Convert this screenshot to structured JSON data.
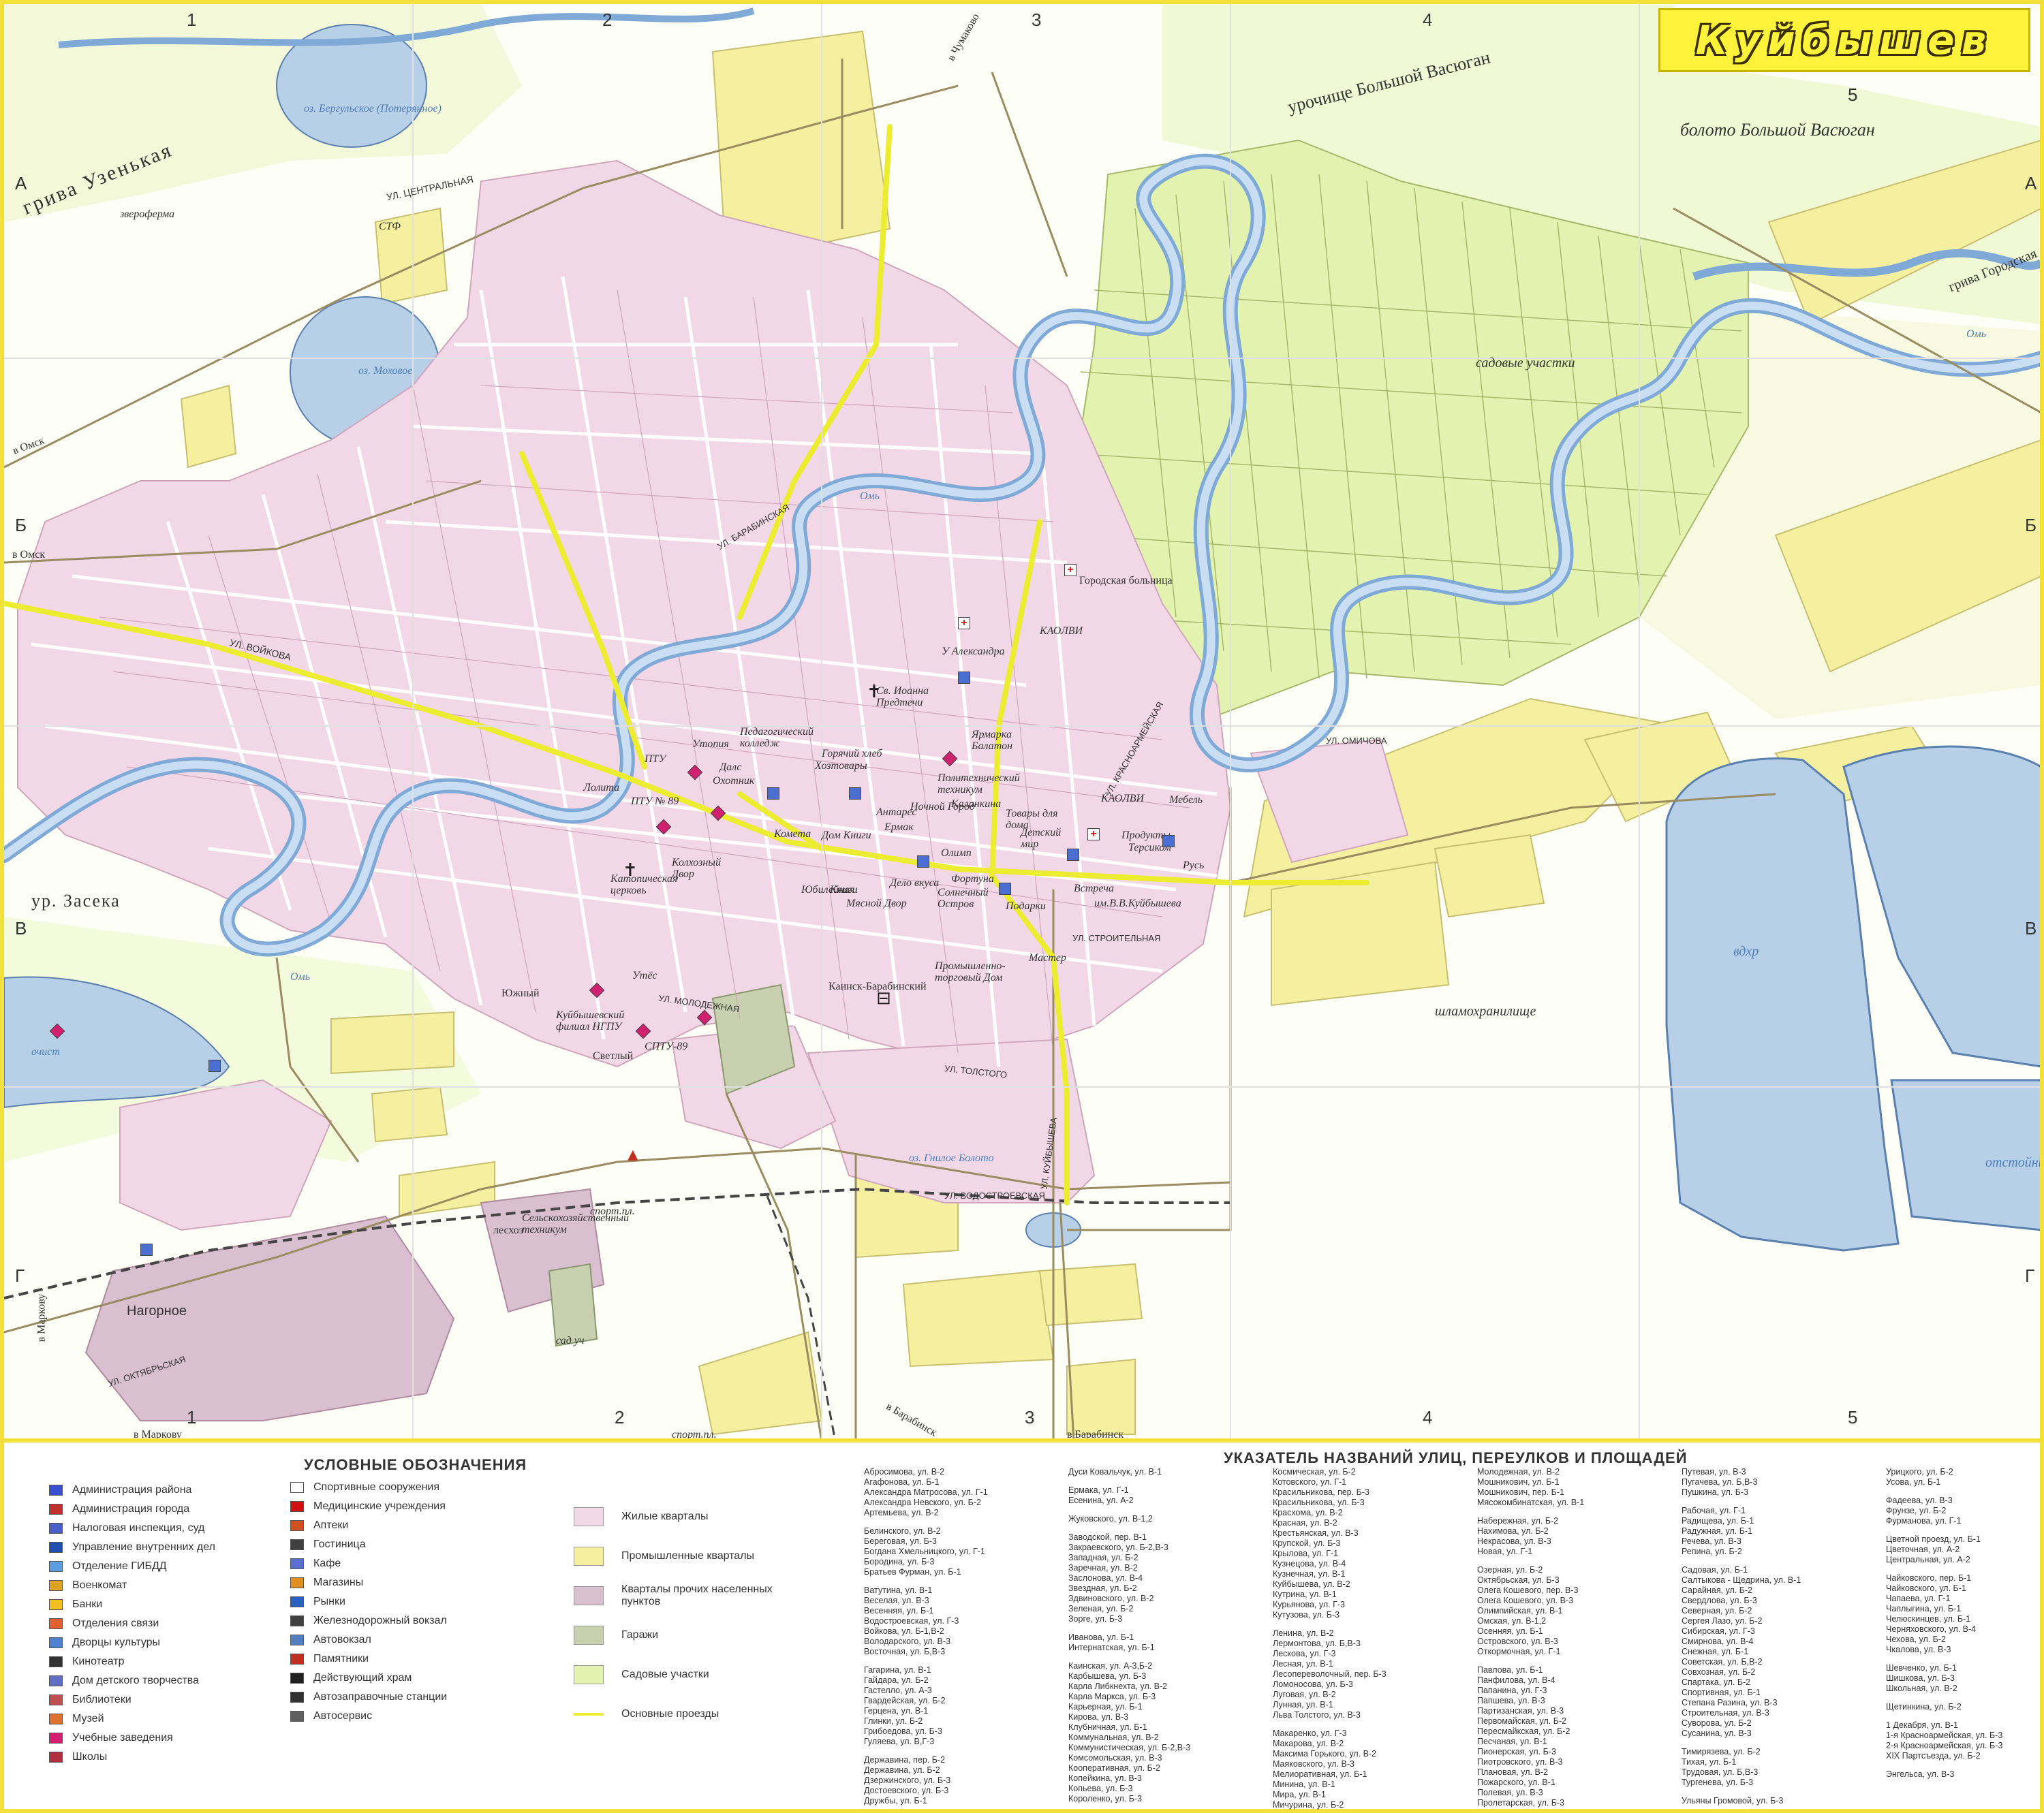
{
  "title": "Куйбышев",
  "grid": {
    "columns": [
      "1",
      "2",
      "3",
      "4",
      "5"
    ],
    "rows": [
      "А",
      "Б",
      "В",
      "Г"
    ]
  },
  "map_labels": {
    "water": [
      "оз. Бергульское (Потерянное)",
      "оз. Моховое",
      "Омь",
      "оз. Гнилое Болото",
      "шламохранилище",
      "вдхр",
      "отстойник",
      "очист",
      "Омь",
      "Омь"
    ],
    "areas": [
      "грива Узенькая",
      "болото Большой Васюган",
      "урочище Большой Васюган",
      "грива Городская",
      "садовые участки",
      "ур. Засека",
      "Нагорное",
      "Южный",
      "Светлый",
      "звероферма",
      "СТФ",
      "лесхоз",
      "спорт.пл.",
      "сад уч",
      "спорт.пл.",
      "Городская больница",
      "Каинск-Барабинский"
    ],
    "roads": [
      "в Омск",
      "в Омск",
      "в Маркову",
      "в Маркову",
      "в Барабинск",
      "в Барабинск",
      "в Чумаково"
    ],
    "streets": [
      "УЛ. ЦЕНТРАЛЬНАЯ",
      "УЛ. ВОЙКОВА",
      "УЛ. КРАСНОАРМЕЙСКАЯ",
      "УЛ. СТРОИТЕЛЬНАЯ",
      "УЛ. ОМИЧОВА",
      "УЛ. МОЛОДЕЖНАЯ",
      "УЛ. ОКТЯБРЬСКАЯ",
      "УЛ. КУЙБЫШЕВА",
      "УЛ. БАРАБИНСКАЯ",
      "УЛ. ТОЛСТОГО",
      "УЛ. ВОДОСТРОЕВСКАЯ"
    ],
    "places": [
      "ПТУ",
      "Утопия",
      "Педагогический колледж",
      "Горячий хлеб",
      "Хозтовары",
      "Далс",
      "Охотник",
      "Лолита",
      "ПТУ № 89",
      "Комета",
      "Дом Книги",
      "Антарес",
      "Ермак",
      "Олимп",
      "Фортуна",
      "Книги",
      "Мясной Двор",
      "Дело вкуса",
      "Солнечный Остров",
      "Юбилейная",
      "Катопическая церковь",
      "Колхозный Двор",
      "Политехнический техникум",
      "Каланкина",
      "Товары для дома",
      "Детский мир",
      "КАОЛВИ",
      "Мебель",
      "Продукты",
      "Терсиком",
      "Русь",
      "Встреча",
      "Подарки",
      "Мастер",
      "Промышленно-торговый Дом",
      "им.В.В.Куйбышева",
      "Сельскохозяйственный техникум",
      "Куйбышевский филиал НГПУ",
      "СПТУ-89",
      "Утёс",
      "Св. Иоанна Предтечи",
      "Ярмарка Балатон",
      "У Александра",
      "КАОЛВИ",
      "Ночной Город"
    ]
  },
  "legend": {
    "title": "УСЛОВНЫЕ ОБОЗНАЧЕНИЯ",
    "col1": [
      {
        "label": "Администрация района",
        "color": "#3a4fd0"
      },
      {
        "label": "Администрация города",
        "color": "#c03030"
      },
      {
        "label": "Налоговая инспекция, суд",
        "color": "#4a60c8"
      },
      {
        "label": "Управление внутренних дел",
        "color": "#2050b0"
      },
      {
        "label": "Отделение ГИБДД",
        "color": "#5aa0e0"
      },
      {
        "label": "Военкомат",
        "color": "#e0a020"
      },
      {
        "label": "Банки",
        "color": "#f0c020"
      },
      {
        "label": "Отделения связи",
        "color": "#e06030"
      },
      {
        "label": "Дворцы культуры",
        "color": "#5080d0"
      },
      {
        "label": "Кинотеатр",
        "color": "#333333"
      },
      {
        "label": "Дом детского творчества",
        "color": "#6070c0"
      },
      {
        "label": "Библиотеки",
        "color": "#c05050"
      },
      {
        "label": "Музей",
        "color": "#e07030"
      },
      {
        "label": "Учебные заведения",
        "color": "#d02070"
      },
      {
        "label": "Школы",
        "color": "#b03040"
      }
    ],
    "col2": [
      {
        "label": "Спортивные сооружения",
        "color": "#ffffff"
      },
      {
        "label": "Медицинские учреждения",
        "color": "#d01010"
      },
      {
        "label": "Аптеки",
        "color": "#d05020"
      },
      {
        "label": "Гостиница",
        "color": "#404040"
      },
      {
        "label": "Кафе",
        "color": "#5a70d0"
      },
      {
        "label": "Магазины",
        "color": "#e09020"
      },
      {
        "label": "Рынки",
        "color": "#2a60c0"
      },
      {
        "label": "Железнодорожный вокзал",
        "color": "#404040"
      },
      {
        "label": "Автовокзал",
        "color": "#5080c0"
      },
      {
        "label": "Памятники",
        "color": "#c03020"
      },
      {
        "label": "Действующий храм",
        "color": "#202020"
      },
      {
        "label": "Автозаправочные станции",
        "color": "#303030"
      },
      {
        "label": "Автосервис",
        "color": "#606060"
      }
    ],
    "areas": [
      {
        "label": "Жилые кварталы",
        "color": "#f2d8e6"
      },
      {
        "label": "Промышленные кварталы",
        "color": "#f4f0a0"
      },
      {
        "label": "Кварталы прочих населенных пунктов",
        "color": "#d9bfd0"
      },
      {
        "label": "Гаражи",
        "color": "#c8d0b0"
      },
      {
        "label": "Садовые участки",
        "color": "#e4f2b0"
      }
    ],
    "line": {
      "label": "Основные проезды",
      "color": "#ecec30"
    }
  },
  "street_index": {
    "title": "УКАЗАТЕЛЬ НАЗВАНИЙ УЛИЦ, ПЕРЕУЛКОВ И ПЛОЩАДЕЙ",
    "columns": [
      [
        "Абросимова, ул. В-2",
        "Агафонова, ул. Б-1",
        "Александра Матросова, ул. Г-1",
        "Александра Невского, ул. Б-2",
        "Артемьева, ул. В-2",
        "",
        "Белинского, ул. В-2",
        "Береговая, ул. Б-3",
        "Богдана Хмельницкого, ул. Г-1",
        "Бородина, ул. Б-3",
        "Братьев Фурман, ул. Б-1",
        "",
        "Ватутина, ул. В-1",
        "Веселая, ул. В-3",
        "Весенняя, ул. Б-1",
        "Водостроевская, ул. Г-3",
        "Войкова, ул. Б-1,В-2",
        "Володарского, ул. В-3",
        "Восточная, ул. Б,В-3",
        "",
        "Гагарина, ул. В-1",
        "Гайдара, ул. Б-2",
        "Гастелло, ул. А-3",
        "Гвардейская, ул. Б-2",
        "Герцена, ул. В-1",
        "Глинки, ул. Б-2",
        "Грибоедова, ул. Б-3",
        "Гуляева, ул. В,Г-3",
        "",
        "Державина, пер. Б-2",
        "Державина, ул. Б-2",
        "Дзержинского, ул. Б-3",
        "Достоевского, ул. Б-3",
        "Дружбы, ул. Б-1"
      ],
      [
        "Дуси Ковальчук, ул. В-1",
        "",
        "Ермака, ул. Г-1",
        "Есенина, ул. А-2",
        "",
        "Жуковского, ул. В-1,2",
        "",
        "Заводской, пер. В-1",
        "Закраевского, ул. Б-2,В-3",
        "Западная, ул. Б-2",
        "Заречная, ул. В-2",
        "Заслонова, ул. В-4",
        "Звездная, ул. Б-2",
        "Здвиновского, ул. В-2",
        "Зеленая, ул. Б-2",
        "Зорге, ул. Б-3",
        "",
        "Иванова, ул. Б-1",
        "Интернатская, ул. Б-1",
        "",
        "Каинская, ул. А-3,Б-2",
        "Карбышева, ул. Б-3",
        "Карла Либкнехта, ул. В-2",
        "Карла Маркса, ул. Б-3",
        "Карьерная, ул. Б-1",
        "Кирова, ул. В-3",
        "Клубничная, ул. Б-1",
        "Коммунальная, ул. В-2",
        "Коммунистическая, ул. Б-2,В-3",
        "Комсомольская, ул. В-3",
        "Кооперативная, ул. Б-2",
        "Копейкина, ул. В-3",
        "Копьева, ул. Б-3",
        "Короленко, ул. Б-3"
      ],
      [
        "Космическая, ул. Б-2",
        "Котовского, ул. Г-1",
        "Красильникова, пер. Б-3",
        "Красильникова, ул. Б-3",
        "Красхома, ул. В-2",
        "Красная, ул. В-2",
        "Крестьянская, ул. В-3",
        "Крупской, ул. Б-3",
        "Крылова, ул. Г-1",
        "Кузнецова, ул. В-4",
        "Кузнечная, ул. В-1",
        "Куйбышева, ул. В-2",
        "Кутрина, ул. В-1",
        "Курьянова, ул. Г-3",
        "Кутузова, ул. Б-3",
        "",
        "Ленина, ул. В-2",
        "Лермонтова, ул. Б,В-3",
        "Лескова, ул. Г-3",
        "Лесная, ул. В-1",
        "Лесопереволочный, пер. Б-3",
        "Ломоносова, ул. Б-3",
        "Луговая, ул. В-2",
        "Лунная, ул. В-1",
        "Льва Толстого, ул. В-3",
        "",
        "Макаренко, ул. Г-3",
        "Макарова, ул. В-2",
        "Максима Горького, ул. В-2",
        "Маяковского, ул. В-3",
        "Мелиоративная, ул. Б-1",
        "Минина, ул. В-1",
        "Мира, ул. В-1",
        "Мичурина, ул. Б-2"
      ],
      [
        "Молодежная, ул. В-2",
        "Мошникович, ул. Б-1",
        "Мошникович, пер. Б-1",
        "Мясокомбинатская, ул. В-1",
        "",
        "Набережная, ул. Б-2",
        "Нахимова, ул. Б-2",
        "Некрасова, ул. В-3",
        "Новая, ул. Г-1",
        "",
        "Озерная, ул. Б-2",
        "Октябрьская, ул. Б-3",
        "Олега Кошевого, пер. В-3",
        "Олега Кошевого, ул. В-3",
        "Олимпийская, ул. В-1",
        "Омская, ул. В-1,2",
        "Осенняя, ул. Б-1",
        "Островского, ул. В-3",
        "Откормочная, ул. Г-1",
        "",
        "Павлова, ул. Б-1",
        "Панфилова, ул. В-4",
        "Папанина, ул. Г-3",
        "Папшева, ул. В-3",
        "Партизанская, ул. В-3",
        "Первомайская, ул. Б-2",
        "Пересмайкская, ул. Б-2",
        "Песчаная, ул. В-1",
        "Пионерская, ул. Б-3",
        "Пиотровского, ул. В-3",
        "Плановая, ул. В-2",
        "Пожарского, ул. В-1",
        "Полевая, ул. В-3",
        "Пролетарская, ул. Б-3"
      ],
      [
        "Путевая, ул. В-3",
        "Пугачева, ул. Б,В-3",
        "Пушкина, ул. Б-3",
        "",
        "Рабочая, ул. Г-1",
        "Радищева, ул. Б-1",
        "Радужная, ул. Б-1",
        "Речева, ул. В-3",
        "Репина, ул. Б-2",
        "",
        "Садовая, ул. Б-1",
        "Салтыкова - Щедрина, ул. В-1",
        "Сарайная, ул. Б-2",
        "Свердлова, ул. Б-3",
        "Северная, ул. Б-2",
        "Сергея Лазо, ул. Б-2",
        "Сибирская, ул. Г-3",
        "Смирнова, ул. В-4",
        "Снежная, ул. Б-1",
        "Советская, ул. Б,В-2",
        "Совхозная, ул. Б-2",
        "Спартака, ул. Б-2",
        "Спортивная, ул. Б-1",
        "Степана Разина, ул. В-3",
        "Строительная, ул. В-3",
        "Суворова, ул. Б-2",
        "Сусанина, ул. В-3",
        "",
        "Тимирязева, ул. Б-2",
        "Тихая, ул. Б-1",
        "Трудовая, ул. Б,В-3",
        "Тургенева, ул. Б-3",
        "",
        "Ульяны Громовой, ул. Б-3"
      ],
      [
        "Урицкого, ул. Б-2",
        "Усова, ул. Б-1",
        "",
        "Фадеева, ул. В-3",
        "Фрунзе, ул. Б-2",
        "Фурманова, ул. Г-1",
        "",
        "Цветной проезд, ул. Б-1",
        "Цветочная, ул. А-2",
        "Центральная, ул. А-2",
        "",
        "Чайковского, пер. Б-1",
        "Чайковского, ул. Б-1",
        "Чапаева, ул. Г-1",
        "Чаплыгина, ул. Б-1",
        "Челюскинцев, ул. Б-1",
        "Черняховского, ул. В-4",
        "Чехова, ул. Б-2",
        "Чкалова, ул. В-3",
        "",
        "Шевченко, ул. Б-1",
        "Шишкова, ул. Б-3",
        "Школьная, ул. В-2",
        "",
        "Щетинкина, ул. Б-2",
        "",
        "1 Декабря, ул. В-1",
        "1-я Красноармейская, ул. Б-3",
        "2-я Красноармейская, ул. Б-3",
        "XIX Партсъезда, ул. Б-2",
        "",
        "Энгельса, ул. В-3"
      ]
    ]
  }
}
